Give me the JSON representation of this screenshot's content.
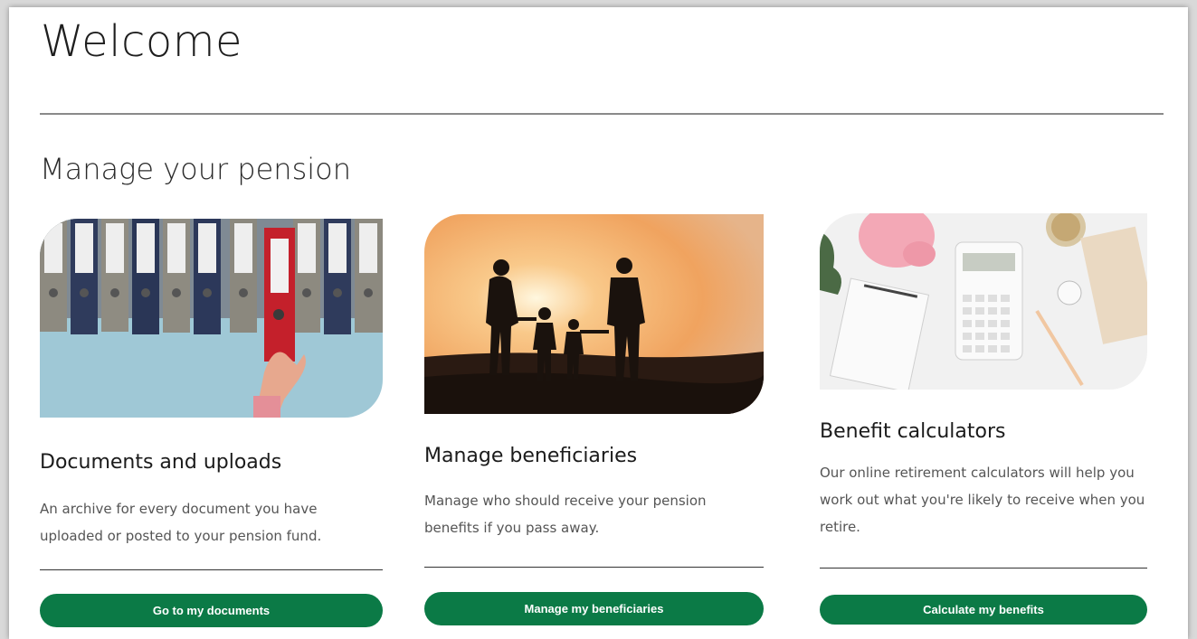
{
  "header": {
    "title": "Welcome"
  },
  "section": {
    "title": "Manage your pension"
  },
  "cards": [
    {
      "title": "Documents and uploads",
      "description": "An archive for every document you have uploaded or posted to your pension fund.",
      "button_label": "Go to my documents",
      "image": "binders-on-shelf"
    },
    {
      "title": "Manage beneficiaries",
      "description": "Manage who should receive your pension benefits if you pass away.",
      "button_label": "Manage my beneficiaries",
      "image": "family-silhouette-sunset"
    },
    {
      "title": "Benefit calculators",
      "description": "Our online retirement calculators will help you work out what you're likely to receive when you retire.",
      "button_label": "Calculate my benefits",
      "image": "calculator-piggy-bank-desk"
    }
  ],
  "colors": {
    "button": "#0b7a46",
    "button_text": "#ffffff",
    "divider": "#8a8a8a"
  }
}
